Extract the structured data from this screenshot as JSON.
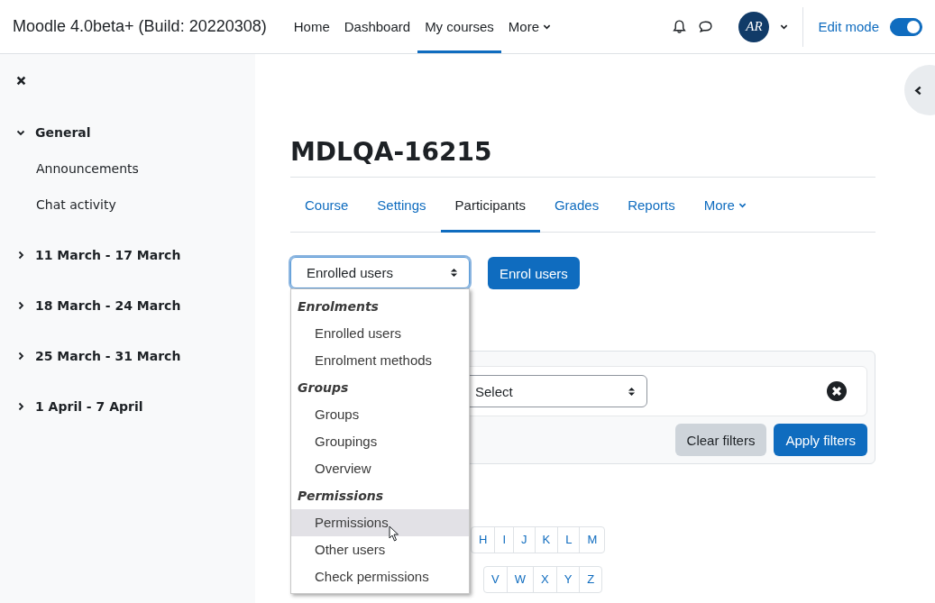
{
  "header": {
    "site_name": "Moodle 4.0beta+ (Build: 20220308)",
    "nav": [
      {
        "label": "Home",
        "selected": false,
        "dropdown": false
      },
      {
        "label": "Dashboard",
        "selected": false,
        "dropdown": false
      },
      {
        "label": "My courses",
        "selected": true,
        "dropdown": false
      },
      {
        "label": "More",
        "selected": false,
        "dropdown": true
      }
    ],
    "avatar_text": "AR",
    "edit_mode": {
      "label": "Edit mode",
      "on": true
    }
  },
  "sidebar": {
    "items": [
      {
        "label": "General",
        "expanded": true,
        "children": [
          {
            "label": "Announcements"
          },
          {
            "label": "Chat activity"
          }
        ]
      },
      {
        "label": "11 March - 17 March",
        "expanded": false
      },
      {
        "label": "18 March - 24 March",
        "expanded": false
      },
      {
        "label": "25 March - 31 March",
        "expanded": false
      },
      {
        "label": "1 April - 7 April",
        "expanded": false
      }
    ]
  },
  "course_title": "MDLQA-16215",
  "tabs": [
    {
      "label": "Course",
      "selected": false,
      "dropdown": false
    },
    {
      "label": "Settings",
      "selected": false,
      "dropdown": false
    },
    {
      "label": "Participants",
      "selected": true,
      "dropdown": false
    },
    {
      "label": "Grades",
      "selected": false,
      "dropdown": false
    },
    {
      "label": "Reports",
      "selected": false,
      "dropdown": false
    },
    {
      "label": "More",
      "selected": false,
      "dropdown": true
    }
  ],
  "page_select": {
    "value": "Enrolled users",
    "expanded": true
  },
  "enrol_button": "Enrol users",
  "dropdown": {
    "groups": [
      {
        "label": "Enrolments",
        "options": [
          {
            "label": "Enrolled users",
            "selected": false
          },
          {
            "label": "Enrolment methods",
            "selected": false
          }
        ]
      },
      {
        "label": "Groups",
        "options": [
          {
            "label": "Groups",
            "selected": false
          },
          {
            "label": "Groupings",
            "selected": false
          },
          {
            "label": "Overview",
            "selected": false
          }
        ]
      },
      {
        "label": "Permissions",
        "options": [
          {
            "label": "Permissions",
            "selected": true
          },
          {
            "label": "Other users",
            "selected": false
          },
          {
            "label": "Check permissions",
            "selected": false
          }
        ]
      }
    ]
  },
  "filters": {
    "select_value": "Select",
    "clear_button": "Clear filters",
    "apply_button": "Apply filters"
  },
  "letter_rows": [
    [
      "H",
      "I",
      "J",
      "K",
      "L",
      "M"
    ],
    [
      "V",
      "W",
      "X",
      "Y",
      "Z"
    ]
  ]
}
